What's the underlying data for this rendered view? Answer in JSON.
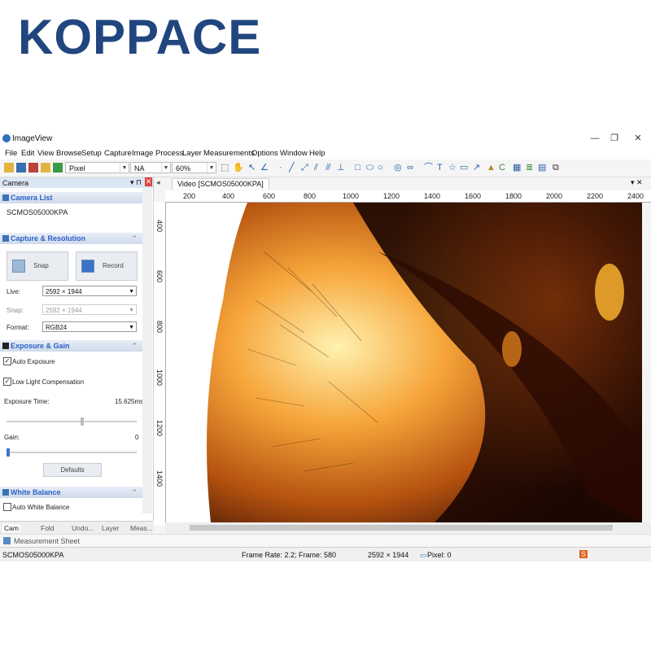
{
  "brand": {
    "logo_text": "KOPPACE"
  },
  "window": {
    "title": "ImageView",
    "min": "—",
    "restore": "❐",
    "close": "✕"
  },
  "menu": [
    "File",
    "Edit",
    "View",
    "Browse",
    "Setup",
    "Capture",
    "Image",
    "Process",
    "Layer",
    "Measurements",
    "Options",
    "Window",
    "Help"
  ],
  "toolbar": {
    "unit_select": "Pixel",
    "na_select": "NA",
    "zoom_select": "60%"
  },
  "panel": {
    "title": "Camera",
    "camera_list": {
      "header": "Camera List",
      "item": "SCMOS05000KPA"
    },
    "capture": {
      "header": "Capture & Resolution",
      "snap_label": "Snap",
      "record_label": "Record",
      "live_label": "Live:",
      "live_value": "2592 × 1944",
      "snap_res_label": "Snap:",
      "snap_res_value": "2592 × 1944",
      "format_label": "Format:",
      "format_value": "RGB24"
    },
    "exposure": {
      "header": "Exposure & Gain",
      "auto_exposure": "Auto Exposure",
      "low_light": "Low Light Compensation",
      "time_label": "Exposure Time:",
      "time_value": "15.625ms",
      "gain_label": "Gain:",
      "gain_value": "0",
      "defaults": "Defaults"
    },
    "white_balance": {
      "header": "White Balance",
      "auto_wb": "Auto White Balance"
    }
  },
  "bottom_tabs": [
    "Cam",
    "Fold",
    "Undo...",
    "Layer",
    "Meas..."
  ],
  "video_tab": "Video [SCMOS05000KPA]",
  "h_ruler": [
    "200",
    "400",
    "600",
    "800",
    "1000",
    "1200",
    "1400",
    "1600",
    "1800",
    "2000",
    "2200",
    "2400"
  ],
  "v_ruler": [
    "400",
    "600",
    "800",
    "1000",
    "1200",
    "1400"
  ],
  "measurement_sheet": "Measurement Sheet",
  "status": {
    "camera": "SCMOS05000KPA",
    "frame": "Frame Rate: 2.2; Frame: 580",
    "size": "2592 × 1944",
    "pixel": "Pixel: 0"
  },
  "colors": {
    "brand_blue": "#21467f",
    "brand_red": "#d8342a",
    "accent": "#2a62c8"
  }
}
